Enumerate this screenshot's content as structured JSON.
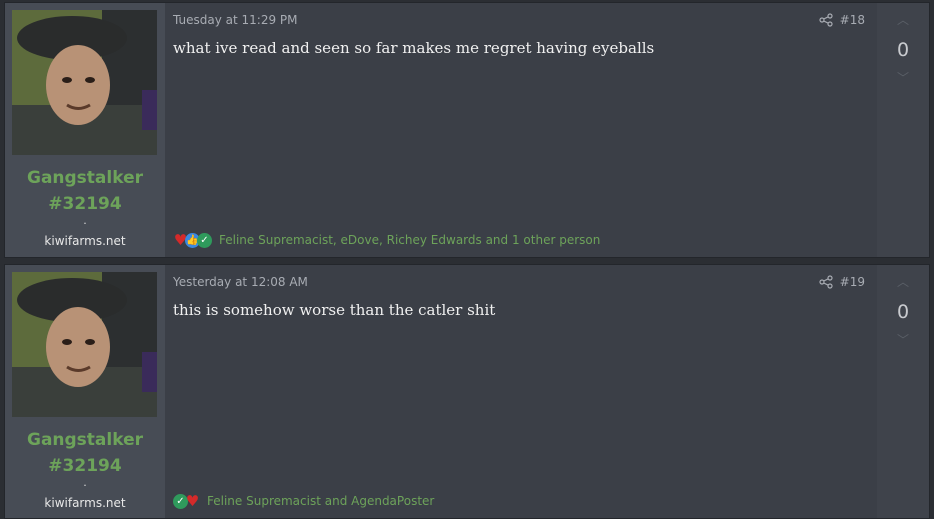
{
  "posts": [
    {
      "username_line1": "Gangstalker",
      "username_line2": "#32194",
      "dot": ".",
      "site": "kiwifarms.net",
      "timestamp": "Tuesday at 11:29 PM",
      "post_number": "#18",
      "body": "what ive read and seen so far makes me regret having eyeballs",
      "reactions_text": "Feline Supremacist, eDove, Richey Edwards and 1 other person",
      "reaction_icons": [
        "heart-icon",
        "thumbs-up-icon",
        "check-icon"
      ],
      "vote_count": "0"
    },
    {
      "username_line1": "Gangstalker",
      "username_line2": "#32194",
      "dot": ".",
      "site": "kiwifarms.net",
      "timestamp": "Yesterday at 12:08 AM",
      "post_number": "#19",
      "body": "this is somehow worse than the catler shit",
      "reactions_text": "Feline Supremacist and AgendaPoster",
      "reaction_icons": [
        "check-icon",
        "heart-icon"
      ],
      "vote_count": "0"
    }
  ],
  "colors": {
    "username": "#6da35a",
    "background": "#3b3f47",
    "sidebar": "#474c55"
  }
}
